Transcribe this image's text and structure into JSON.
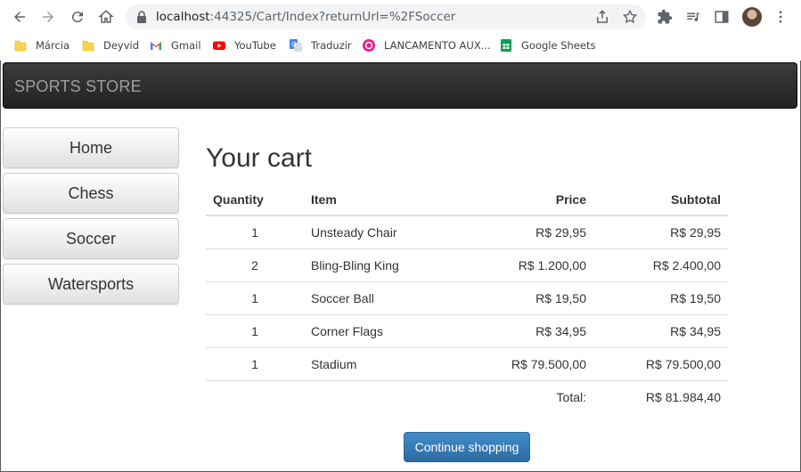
{
  "browser": {
    "url_host": "localhost",
    "url_path": ":44325/Cart/Index?returnUrl=%2FSoccer",
    "bookmarks": [
      {
        "label": "Márcia",
        "icon": "folder-icon"
      },
      {
        "label": "Deyvid",
        "icon": "folder-icon"
      },
      {
        "label": "Gmail",
        "icon": "gmail-icon"
      },
      {
        "label": "YouTube",
        "icon": "youtube-icon"
      },
      {
        "label": "Traduzir",
        "icon": "translate-icon"
      },
      {
        "label": "LANCAMENTO AUX...",
        "icon": "app-icon"
      },
      {
        "label": "Google Sheets",
        "icon": "sheets-icon"
      }
    ]
  },
  "navbar": {
    "brand": "SPORTS STORE"
  },
  "categories": [
    "Home",
    "Chess",
    "Soccer",
    "Watersports"
  ],
  "cart": {
    "title": "Your cart",
    "headers": {
      "quantity": "Quantity",
      "item": "Item",
      "price": "Price",
      "subtotal": "Subtotal"
    },
    "rows": [
      {
        "quantity": "1",
        "item": "Unsteady Chair",
        "price": "R$ 29,95",
        "subtotal": "R$ 29,95"
      },
      {
        "quantity": "2",
        "item": "Bling-Bling King",
        "price": "R$ 1.200,00",
        "subtotal": "R$ 2.400,00"
      },
      {
        "quantity": "1",
        "item": "Soccer Ball",
        "price": "R$ 19,50",
        "subtotal": "R$ 19,50"
      },
      {
        "quantity": "1",
        "item": "Corner Flags",
        "price": "R$ 34,95",
        "subtotal": "R$ 34,95"
      },
      {
        "quantity": "1",
        "item": "Stadium",
        "price": "R$ 79.500,00",
        "subtotal": "R$ 79.500,00"
      }
    ],
    "total_label": "Total:",
    "total_value": "R$ 81.984,40",
    "continue_label": "Continue shopping"
  },
  "colors": {
    "navbar": "#222222",
    "brand_text": "#9d9d9d",
    "primary_button": "#428bca"
  }
}
